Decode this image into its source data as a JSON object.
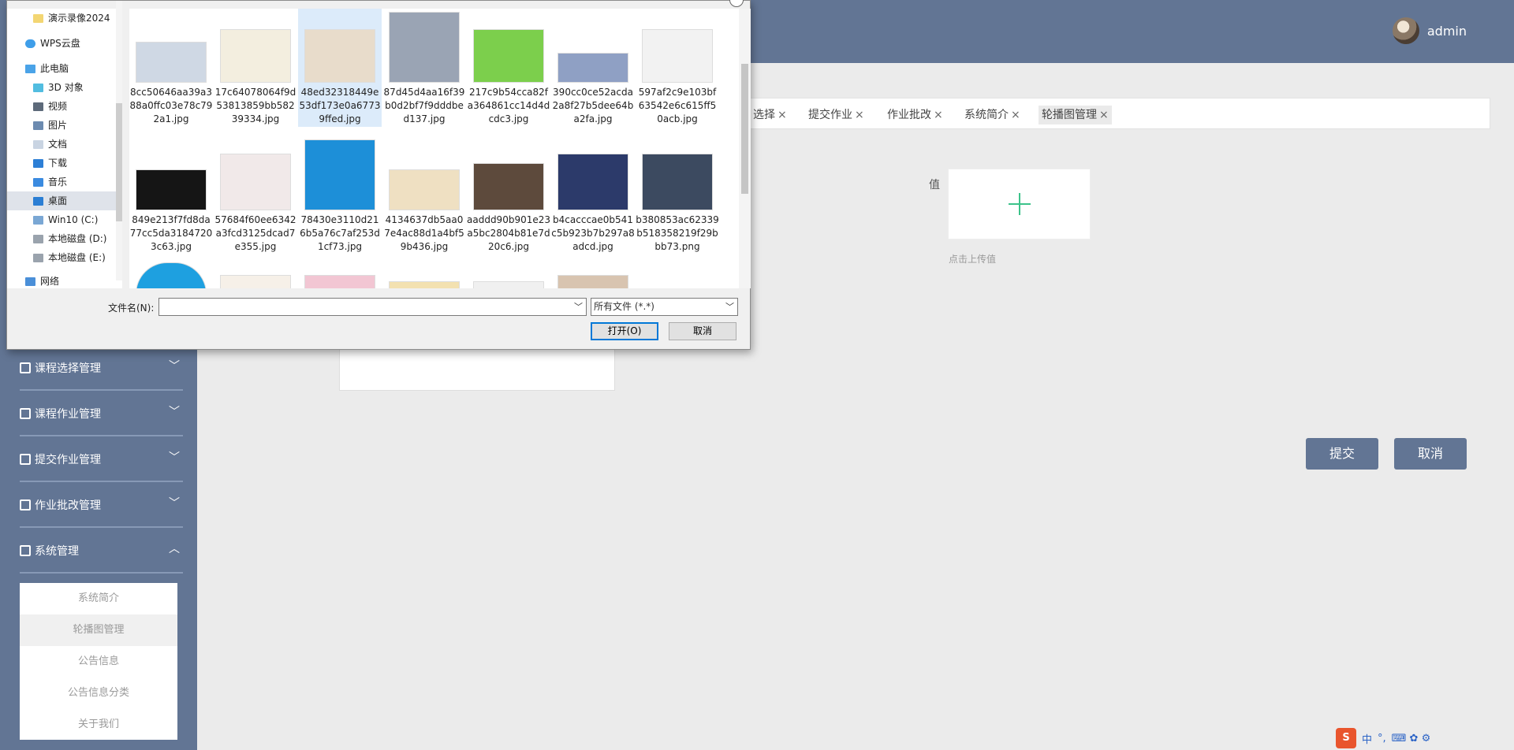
{
  "header": {
    "username": "admin"
  },
  "sidebar": {
    "menus": [
      {
        "label": "课程选择管理",
        "chevron": "﹀"
      },
      {
        "label": "课程作业管理",
        "chevron": "﹀"
      },
      {
        "label": "提交作业管理",
        "chevron": "﹀"
      },
      {
        "label": "作业批改管理",
        "chevron": "﹀"
      },
      {
        "label": "系统管理",
        "chevron": "︿"
      }
    ],
    "submenu": [
      "系统简介",
      "轮播图管理",
      "公告信息",
      "公告信息分类",
      "关于我们"
    ],
    "active_submenu": "轮播图管理"
  },
  "tabs": [
    {
      "label": "选择"
    },
    {
      "label": "提交作业"
    },
    {
      "label": "作业批改"
    },
    {
      "label": "系统简介"
    },
    {
      "label": "轮播图管理",
      "active": true
    }
  ],
  "tab_close": "×",
  "form": {
    "value_label": "值",
    "upload_hint": "点击上传值",
    "submit_label": "提交",
    "cancel_label": "取消"
  },
  "dialog": {
    "nav": [
      {
        "label": "演示录像2024",
        "icon": "folder-icon"
      },
      {
        "label": "WPS云盘",
        "icon": "cloud-icon"
      },
      {
        "label": "此电脑",
        "icon": "computer-icon"
      },
      {
        "label": "3D 对象",
        "icon": "cube-icon"
      },
      {
        "label": "视频",
        "icon": "video-icon"
      },
      {
        "label": "图片",
        "icon": "pictures-icon"
      },
      {
        "label": "文档",
        "icon": "document-icon"
      },
      {
        "label": "下载",
        "icon": "download-icon"
      },
      {
        "label": "音乐",
        "icon": "music-icon"
      },
      {
        "label": "桌面",
        "icon": "desktop-icon",
        "selected": true
      },
      {
        "label": "Win10 (C:)",
        "icon": "drive-icon"
      },
      {
        "label": "本地磁盘 (D:)",
        "icon": "drive-icon"
      },
      {
        "label": "本地磁盘 (E:)",
        "icon": "drive-icon"
      },
      {
        "label": "网络",
        "icon": "network-icon"
      }
    ],
    "files": [
      {
        "name": "8cc50646aa39a388a0ffc03e78c792a1.jpg",
        "color": "#cfd8e4"
      },
      {
        "name": "17c64078064f9d53813859bb58239334.jpg",
        "color": "#f3eedf"
      },
      {
        "name": "48ed32318449e53df173e0a67739ffed.jpg",
        "color": "#e8dccb",
        "selected": true
      },
      {
        "name": "87d45d4aa16f39b0d2bf7f9dddbed137.jpg",
        "color": "#9aa4b4"
      },
      {
        "name": "217c9b54cca82fa364861cc14d4dcdc3.jpg",
        "color": "#7ccf4c"
      },
      {
        "name": "390cc0ce52acda2a8f27b5dee64ba2fa.jpg",
        "color": "#8fa0c4"
      },
      {
        "name": "597af2c9e103bf63542e6c615ff50acb.jpg",
        "color": "#f2f2f2"
      },
      {
        "name": "849e213f7fd8da77cc5da31847203c63.jpg",
        "color": "#151515"
      },
      {
        "name": "57684f60ee6342a3fcd3125dcad7e355.jpg",
        "color": "#f1e9e9"
      },
      {
        "name": "78430e3110d216b5a76c7af253d1cf73.jpg",
        "color": "#1d8fd8"
      },
      {
        "name": "4134637db5aa07e4ac88d1a4bf59b436.jpg",
        "color": "#efe0c2"
      },
      {
        "name": "aaddd90b901e23a5bc2804b81e7d20c6.jpg",
        "color": "#5d4a3c"
      },
      {
        "name": "b4cacccae0b541c5b923b7b297a8adcd.jpg",
        "color": "#2c3a6a"
      },
      {
        "name": "b380853ac62339b518358219f29bbb73.png",
        "color": "#3c4a60"
      },
      {
        "name": "",
        "color": "#1ea0e0"
      },
      {
        "name": "",
        "color": "#f6f0e8"
      },
      {
        "name": "",
        "color": "#f2c6d3"
      },
      {
        "name": "",
        "color": "#f3e1b0"
      },
      {
        "name": "",
        "color": "#f0f0f0"
      },
      {
        "name": "",
        "color": "#d8c4b0"
      }
    ],
    "filename_label": "文件名(N):",
    "filename_value": "",
    "filter_value": "所有文件 (*.*)",
    "open_label": "打开(O)",
    "cancel_label": "取消"
  },
  "ime": {
    "badge": "S",
    "mode": "中",
    "punct": "°,",
    "extra": "⌨ ✿ ⚙"
  }
}
